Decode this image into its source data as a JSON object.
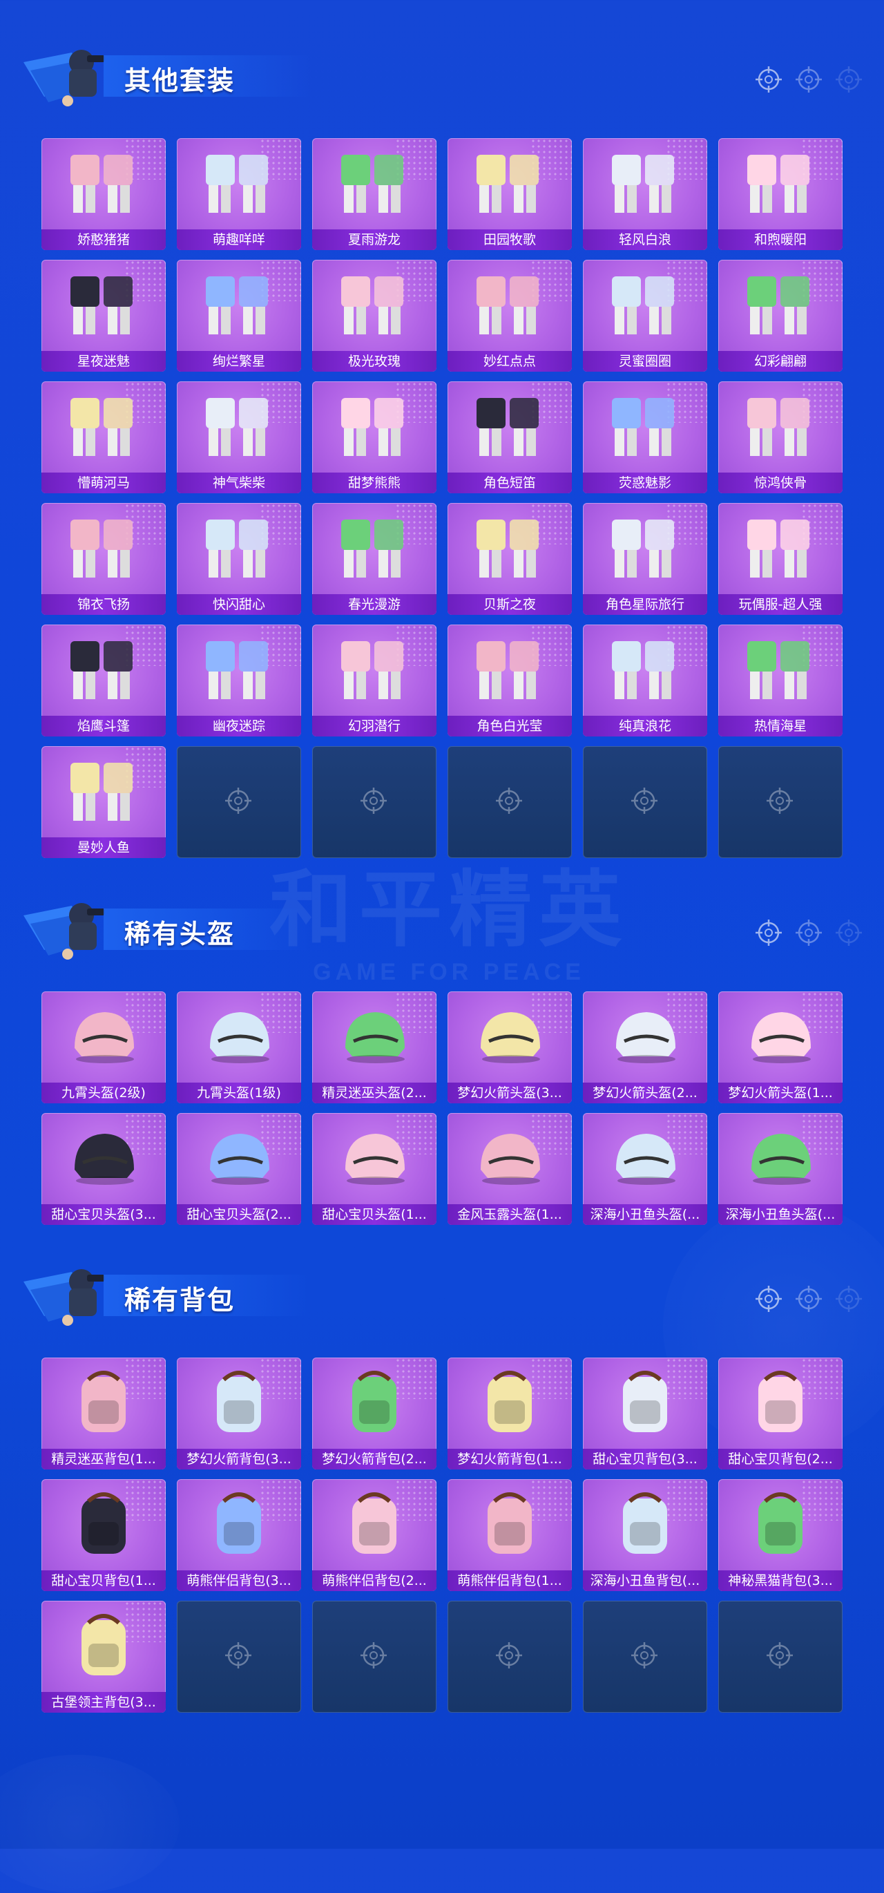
{
  "sections": [
    {
      "title": "其他套装",
      "items": [
        "娇憨猪猪",
        "萌趣咩咩",
        "夏雨游龙",
        "田园牧歌",
        "轻风白浪",
        "和煦暖阳",
        "星夜迷魅",
        "绚烂繁星",
        "极光玫瑰",
        "妙红点点",
        "灵蜜圈圈",
        "幻彩翩翩",
        "懵萌河马",
        "神气柴柴",
        "甜梦熊熊",
        "角色短笛",
        "荧惑魅影",
        "惊鸿侠骨",
        "锦衣飞扬",
        "快闪甜心",
        "春光漫游",
        "贝斯之夜",
        "角色星际旅行",
        "玩偶服-超人强",
        "焰鹰斗篷",
        "幽夜迷踪",
        "幻羽潜行",
        "角色白光莹",
        "纯真浪花",
        "热情海星",
        "曼妙人鱼"
      ],
      "empty_slots": 5
    },
    {
      "title": "稀有头盔",
      "items": [
        "九霄头盔(2级)",
        "九霄头盔(1级)",
        "精灵迷巫头盔(2...",
        "梦幻火箭头盔(3...",
        "梦幻火箭头盔(2...",
        "梦幻火箭头盔(1...",
        "甜心宝贝头盔(3...",
        "甜心宝贝头盔(2...",
        "甜心宝贝头盔(1...",
        "金风玉露头盔(1...",
        "深海小丑鱼头盔(...",
        "深海小丑鱼头盔(..."
      ],
      "empty_slots": 0
    },
    {
      "title": "稀有背包",
      "items": [
        "精灵迷巫背包(1...",
        "梦幻火箭背包(3...",
        "梦幻火箭背包(2...",
        "梦幻火箭背包(1...",
        "甜心宝贝背包(3...",
        "甜心宝贝背包(2...",
        "甜心宝贝背包(1...",
        "萌熊伴侣背包(3...",
        "萌熊伴侣背包(2...",
        "萌熊伴侣背包(1...",
        "深海小丑鱼背包(...",
        "神秘黑猫背包(3...",
        "古堡领主背包(3..."
      ],
      "empty_slots": 5
    }
  ],
  "watermark": {
    "title": "和平精英",
    "subtitle": "GAME FOR PEACE"
  },
  "colors": {
    "background": "#0f46da",
    "card": "#b163e6",
    "label": "#7a27cf",
    "empty_card": "#1e3f7a"
  }
}
